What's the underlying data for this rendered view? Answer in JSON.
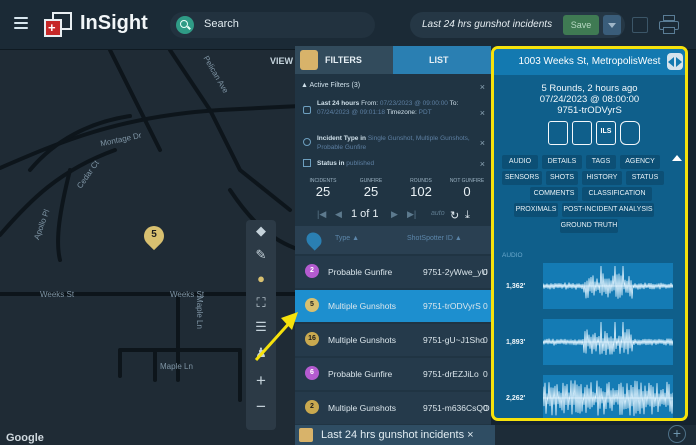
{
  "app": {
    "brand": "InSight",
    "search_placeholder": "Search",
    "filter_title": "Last 24 hrs gunshot incidents",
    "save_label": "Save"
  },
  "map": {
    "view_label": "VIEW",
    "google_label": "Google",
    "pin_number": "5",
    "street_labels": [
      "Weeks St",
      "Weeks St",
      "Maple Ln",
      "Maple Ln",
      "Pelican Ave",
      "Montage Dr",
      "Cedar Ct",
      "Apollo Pl"
    ]
  },
  "panel": {
    "tab_filters": "FILTERS",
    "tab_list": "LIST",
    "active_filters": "Active Filters (3)",
    "filter1_prefix": "Last 24 hours",
    "filter1_from_label": "From:",
    "filter1_from": "07/23/2023 @ 09:00:00",
    "filter1_to_label": "To:",
    "filter1_to": "07/24/2023 @ 09:01:18",
    "filter1_tz_label": "Timezone:",
    "filter1_tz": "PDT",
    "filter2_label": "Incident Type in",
    "filter2_values": "Single Gunshot, Multiple Gunshots, Probable Gunfire",
    "filter3_label": "Status in",
    "filter3_value": "published",
    "stats": [
      {
        "label": "INCIDENTS",
        "value": "25"
      },
      {
        "label": "GUNFIRE",
        "value": "25"
      },
      {
        "label": "ROUNDS",
        "value": "102"
      },
      {
        "label": "NOT GUNFIRE",
        "value": "0"
      }
    ],
    "page_label": "1 of 1",
    "auto_label": "auto",
    "col_type": "Type",
    "col_id": "ShotSpotter ID",
    "rows": [
      {
        "badge": "2",
        "type": "Probable Gunfire",
        "sid": "9751-2yWwe_yU",
        "trail": "0",
        "badge_color": "#b45bd0",
        "badge_text": "#ffffff",
        "selected": false
      },
      {
        "badge": "5",
        "type": "Multiple Gunshots",
        "sid": "9751-trODVyrS",
        "trail": "0",
        "badge_color": "#d8c070",
        "badge_text": "#1d1d1d",
        "selected": true
      },
      {
        "badge": "16",
        "type": "Multiple Gunshots",
        "sid": "9751-gU~J1Sho",
        "trail": "0",
        "badge_color": "#c9a94f",
        "badge_text": "#1d1d1d",
        "selected": false
      },
      {
        "badge": "6",
        "type": "Probable Gunfire",
        "sid": "9751-drEZJiLo",
        "trail": "0",
        "badge_color": "#b45bd0",
        "badge_text": "#ffffff",
        "selected": false
      },
      {
        "badge": "2",
        "type": "Multiple Gunshots",
        "sid": "9751-m636CsQO",
        "trail": "0",
        "badge_color": "#c9a94f",
        "badge_text": "#1d1d1d",
        "selected": false
      }
    ],
    "bottom_tab": "Last 24 hrs gunshot incidents ×"
  },
  "detail": {
    "address": "1003 Weeks St, MetropolisWest",
    "rounds": "5 Rounds, 2 hours ago",
    "datetime": "07/24/2023 @ 08:00:00",
    "incident_id": "9751-trODVyrS",
    "buttons_row1": [
      "AUDIO",
      "DETAILS",
      "TAGS",
      "AGENCY"
    ],
    "buttons_row2": [
      "SENSORS",
      "SHOTS",
      "HISTORY",
      "STATUS"
    ],
    "buttons_row3": [
      "COMMENTS",
      "CLASSIFICATION"
    ],
    "buttons_row4": [
      "PROXIMALS",
      "POST-INCIDENT ANALYSIS"
    ],
    "buttons_row5": [
      "GROUND TRUTH"
    ],
    "audio_label": "AUDIO",
    "audio_clips": [
      {
        "distance": "1,362'"
      },
      {
        "distance": "1,893'"
      },
      {
        "distance": "2,262'"
      }
    ]
  },
  "colors": {
    "highlight": "#f6e20c",
    "selected_row": "#1d8fcf",
    "detail_bg": "#0f5f8b"
  }
}
